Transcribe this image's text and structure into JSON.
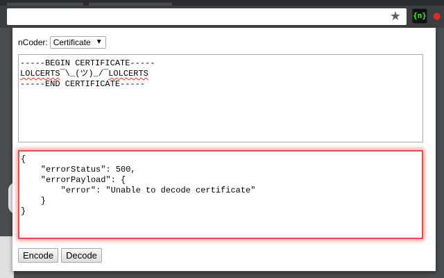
{
  "browser": {
    "star_icon": "★",
    "extension_icon": "{n}",
    "extension_icon_2": "●"
  },
  "popup": {
    "select_label": "nCoder:",
    "select_value": "Certificate",
    "input": {
      "begin": "-----BEGIN CERTIFICATE-----",
      "body_prefix": "LOLCERTS",
      "body_middle": "¯\\_(ツ)_/¯",
      "body_suffix": "LOLCERTS",
      "end": "-----END CERTIFICATE-----"
    },
    "output_text": "{\n    \"errorStatus\": 500,\n    \"errorPayload\": {\n        \"error\": \"Unable to decode certificate\"\n    }\n}",
    "buttons": {
      "encode": "Encode",
      "decode": "Decode"
    }
  },
  "colors": {
    "error_border": "#f04848",
    "extension_icon_text": "#39ff14"
  }
}
